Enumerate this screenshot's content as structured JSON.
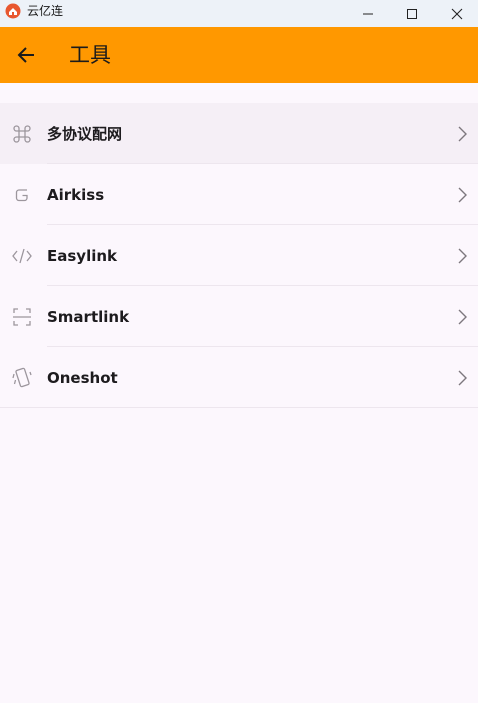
{
  "window": {
    "title": "云亿连",
    "icon": "app-logo-icon",
    "controls": [
      "minimize-icon",
      "maximize-icon",
      "close-icon"
    ]
  },
  "appbar": {
    "back_icon": "arrow-left-icon",
    "title": "工具",
    "background": "#ff9800"
  },
  "menu": {
    "items": [
      {
        "label": "多协议配网",
        "icon": "command-icon"
      },
      {
        "label": "Airkiss",
        "icon": "g-shape-icon"
      },
      {
        "label": "Easylink",
        "icon": "code-icon"
      },
      {
        "label": "Smartlink",
        "icon": "scan-frame-icon"
      },
      {
        "label": "Oneshot",
        "icon": "phone-vibrate-icon"
      }
    ]
  }
}
